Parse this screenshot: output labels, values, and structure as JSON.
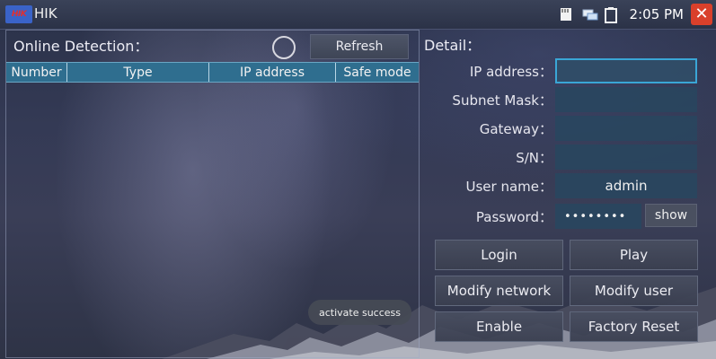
{
  "titlebar": {
    "app_title": "HIK",
    "logo_text": "HIK",
    "time": "2:05 PM",
    "status_icons": [
      "sd-card-icon",
      "network-icon",
      "battery-icon"
    ]
  },
  "online": {
    "title": "Online Detection：",
    "refresh_label": "Refresh",
    "columns": [
      "Number",
      "Type",
      "IP address",
      "Safe mode"
    ]
  },
  "toast": "activate success",
  "detail": {
    "title": "Detail：",
    "fields": [
      {
        "label": "IP address：",
        "value": ""
      },
      {
        "label": "Subnet Mask：",
        "value": ""
      },
      {
        "label": "Gateway：",
        "value": ""
      },
      {
        "label": "S/N：",
        "value": ""
      },
      {
        "label": "User name：",
        "value": "admin"
      },
      {
        "label": "Password：",
        "value": "••••••••"
      }
    ],
    "show_label": "show",
    "buttons": [
      "Login",
      "Play",
      "Modify network",
      "Modify user",
      "Enable",
      "Factory Reset"
    ]
  },
  "colors": {
    "accent": "#3aa6d6",
    "table_header": "#2f6e8f",
    "close": "#d9402b",
    "logo_bg": "#3a63c8"
  }
}
